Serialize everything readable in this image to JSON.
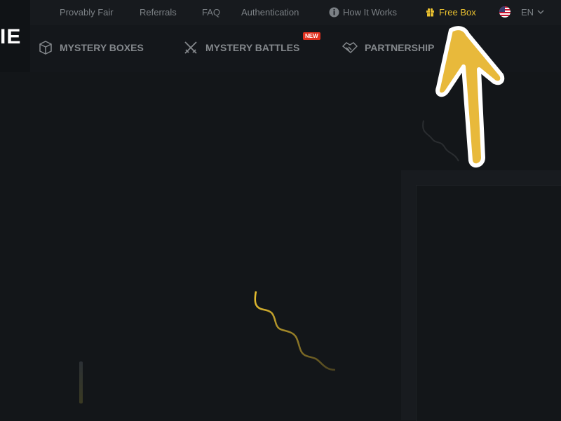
{
  "logo": {
    "text": "IE"
  },
  "topbar": {
    "links": [
      {
        "label": "Provably Fair"
      },
      {
        "label": "Referrals"
      },
      {
        "label": "FAQ"
      },
      {
        "label": "Authentication"
      },
      {
        "label": "How It Works",
        "icon": "info-icon"
      },
      {
        "label": "Free Box",
        "icon": "gift-icon"
      }
    ],
    "language": {
      "label": "EN",
      "icon": "us-flag-icon"
    }
  },
  "nav": {
    "items": [
      {
        "label": "MYSTERY BOXES",
        "icon": "cube-icon"
      },
      {
        "label": "MYSTERY BATTLES",
        "icon": "crossed-swords-icon",
        "badge": "NEW"
      },
      {
        "label": "PARTNERSHIP",
        "icon": "handshake-icon"
      }
    ]
  },
  "colors": {
    "accent": "#e9c02f",
    "badge": "#e0301e",
    "arrow": "#e8b93b"
  }
}
